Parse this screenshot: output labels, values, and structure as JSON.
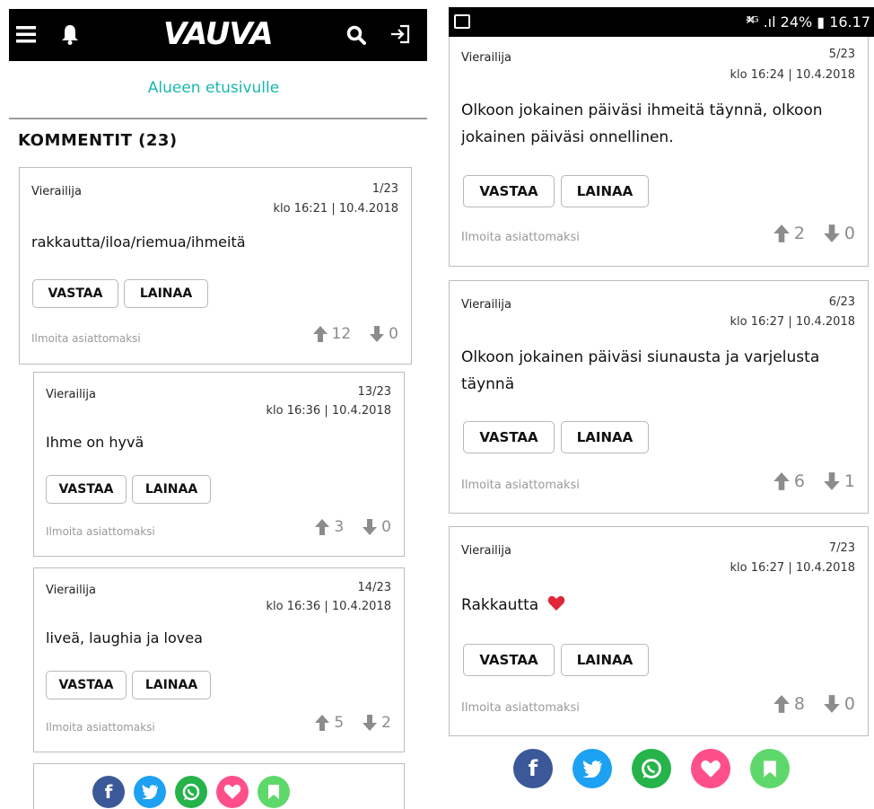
{
  "left": {
    "header": {
      "logo": "VAUVA"
    },
    "area_link": "Alueen etusivulle",
    "comments_title": "KOMMENTIT (23)",
    "comments": [
      {
        "author": "Vierailija",
        "num": "1/23",
        "time": "klo 16:21 | 10.4.2018",
        "body": "rakkautta/iloa/riemua/ihmeitä",
        "up": "12",
        "down": "0"
      },
      {
        "author": "Vierailija",
        "num": "13/23",
        "time": "klo 16:36 | 10.4.2018",
        "body": "Ihme on hyvä",
        "up": "3",
        "down": "0"
      },
      {
        "author": "Vierailija",
        "num": "14/23",
        "time": "klo 16:36 | 10.4.2018",
        "body": "liveä, laughia ja lovea",
        "up": "5",
        "down": "2"
      }
    ]
  },
  "right": {
    "status": {
      "text": "⁴ᴳ .ıl 24% ▮ 16.17"
    },
    "comments": [
      {
        "author": "Vierailija",
        "num": "5/23",
        "time": "klo 16:24 | 10.4.2018",
        "body": "Olkoon jokainen päiväsi ihmeitä täynnä, olkoon jokainen päiväsi onnellinen.",
        "up": "2",
        "down": "0"
      },
      {
        "author": "Vierailija",
        "num": "6/23",
        "time": "klo 16:27 | 10.4.2018",
        "body": "Olkoon jokainen päiväsi siunausta ja varjelusta täynnä",
        "up": "6",
        "down": "1"
      },
      {
        "author": "Vierailija",
        "num": "7/23",
        "time": "klo 16:27 | 10.4.2018",
        "body": "Rakkautta",
        "up": "8",
        "down": "0"
      }
    ]
  },
  "labels": {
    "reply": "VASTAA",
    "quote": "LAINAA",
    "report": "Ilmoita asiattomaksi"
  },
  "colors": {
    "link": "#19b7b0",
    "facebook": "#3b5998",
    "twitter": "#1da1f2",
    "whatsapp": "#25b34a",
    "like": "#ff4f8b",
    "bookmark": "#5fd86b"
  }
}
